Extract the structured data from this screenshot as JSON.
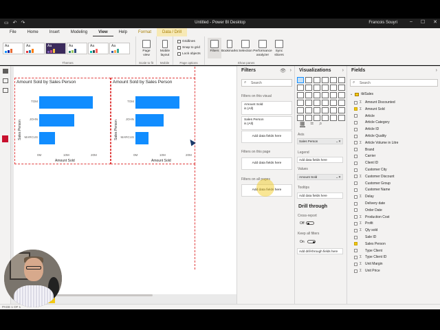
{
  "window": {
    "title": "Untitled - Power BI Desktop",
    "user": "Francois Souyri"
  },
  "tabs": [
    "File",
    "Home",
    "Insert",
    "Modeling",
    "View",
    "Help",
    "Format",
    "Data / Drill"
  ],
  "ribbon": {
    "groups": {
      "themes": "Themes",
      "scale_to_fit": "Scale to fit",
      "mobile": "Mobile",
      "page_options": "Page options",
      "show_panes": "Show panes"
    },
    "page_view": "Page view",
    "mobile_layout": "Mobile layout",
    "gridlines": "Gridlines",
    "snap_to_grid": "Snap to grid",
    "lock_objects": "Lock objects",
    "panes": [
      "Filters",
      "Bookmarks",
      "Selection",
      "Performance analyzer",
      "Sync slicers"
    ],
    "theme_label": "Aa",
    "theme_colors": [
      [
        "#118dff",
        "#12239e",
        "#e66c37"
      ],
      [
        "#e3353c",
        "#1f77b4",
        "#ff7f0e"
      ],
      [
        "#7f5cb8",
        "#c64f8e",
        "#f6c344"
      ],
      [
        "#2f7d6d",
        "#98c85b",
        "#2f4b7c"
      ],
      [
        "#01b8aa",
        "#374649",
        "#fd625e"
      ],
      [
        "#3257a8",
        "#fca652",
        "#37a794"
      ]
    ]
  },
  "visuals": [
    {
      "title": "Amount Sold by Sales Person",
      "ylabel": "Sales Person",
      "xlabel": "Amount Sold",
      "categories": [
        "TOM",
        "JOHN",
        "MARCUS"
      ],
      "ticks": [
        "0M",
        "10M",
        "20M"
      ]
    },
    {
      "title": "Amount Sold by Sales Person",
      "ylabel": "Sales Person",
      "xlabel": "Amount Sold",
      "categories": [
        "TOM",
        "JOHN",
        "MARCUS"
      ],
      "ticks": [
        "0M",
        "10M",
        "20M"
      ]
    }
  ],
  "chart_data": [
    {
      "type": "bar",
      "title": "Amount Sold by Sales Person",
      "xlabel": "Amount Sold",
      "ylabel": "Sales Person",
      "categories": [
        "TOM",
        "JOHN",
        "MARCUS"
      ],
      "values": [
        17,
        11,
        5
      ],
      "xlim": [
        0,
        20
      ],
      "unit": "M"
    },
    {
      "type": "bar",
      "title": "Amount Sold by Sales Person",
      "xlabel": "Amount Sold",
      "ylabel": "Sales Person",
      "categories": [
        "TOM",
        "JOHN",
        "MARCUS"
      ],
      "values": [
        17,
        11,
        5
      ],
      "xlim": [
        0,
        20
      ],
      "unit": "M"
    }
  ],
  "filters": {
    "title": "Filters",
    "search_placeholder": "Search",
    "on_this_visual": "Filters on this visual",
    "cards": [
      {
        "name": "Amount Sold",
        "value": "is (All)"
      },
      {
        "name": "Sales Person",
        "value": "is (All)"
      }
    ],
    "add_data": "Add data fields here",
    "on_this_page": "Filters on this page",
    "on_all_pages": "Filters on all pages"
  },
  "visualizations": {
    "title": "Visualizations",
    "axis": "Axis",
    "axis_value": "Sales Person",
    "legend": "Legend",
    "values": "Values",
    "values_value": "Amount Sold",
    "tooltips": "Tooltips",
    "add_data": "Add data fields here",
    "drill_through": "Drill through",
    "cross_report": "Cross-report",
    "cross_report_state": "Off",
    "keep_all_filters": "Keep all filters",
    "keep_all_filters_state": "On",
    "add_drill": "Add drill-through fields here"
  },
  "fields": {
    "title": "Fields",
    "search_placeholder": "Search",
    "table": "tblSales",
    "items": [
      {
        "name": "Amount Discounted",
        "sigma": true,
        "checked": false
      },
      {
        "name": "Amount Sold",
        "sigma": true,
        "checked": true
      },
      {
        "name": "Article",
        "sigma": false,
        "checked": false
      },
      {
        "name": "Article Category",
        "sigma": false,
        "checked": false
      },
      {
        "name": "Article ID",
        "sigma": false,
        "checked": false
      },
      {
        "name": "Article Quality",
        "sigma": false,
        "checked": false
      },
      {
        "name": "Article Volume in Litre",
        "sigma": true,
        "checked": false
      },
      {
        "name": "Brand",
        "sigma": false,
        "checked": false
      },
      {
        "name": "Carrier",
        "sigma": false,
        "checked": false
      },
      {
        "name": "Client ID",
        "sigma": false,
        "checked": false
      },
      {
        "name": "Customer City",
        "sigma": false,
        "checked": false
      },
      {
        "name": "Customer Discount",
        "sigma": true,
        "checked": false
      },
      {
        "name": "Customer Group",
        "sigma": false,
        "checked": false
      },
      {
        "name": "Customer Name",
        "sigma": false,
        "checked": false
      },
      {
        "name": "Delay",
        "sigma": true,
        "checked": false
      },
      {
        "name": "Delivery date",
        "sigma": false,
        "checked": false
      },
      {
        "name": "Order Date",
        "sigma": false,
        "checked": false
      },
      {
        "name": "Production Cost",
        "sigma": true,
        "checked": false
      },
      {
        "name": "Profit",
        "sigma": true,
        "checked": false
      },
      {
        "name": "Qty sold",
        "sigma": true,
        "checked": false
      },
      {
        "name": "Sale ID",
        "sigma": false,
        "checked": false
      },
      {
        "name": "Sales Person",
        "sigma": false,
        "checked": true
      },
      {
        "name": "Type Client",
        "sigma": false,
        "checked": false
      },
      {
        "name": "Type Client ID",
        "sigma": true,
        "checked": false
      },
      {
        "name": "Unit Margin",
        "sigma": true,
        "checked": false
      },
      {
        "name": "Unit Price",
        "sigma": true,
        "checked": false
      }
    ]
  },
  "status": {
    "page": "PAGE 1 OF 1"
  },
  "colors": {
    "bar": "#118dff",
    "accent": "#f2c811",
    "selection": "#e03a3a"
  }
}
